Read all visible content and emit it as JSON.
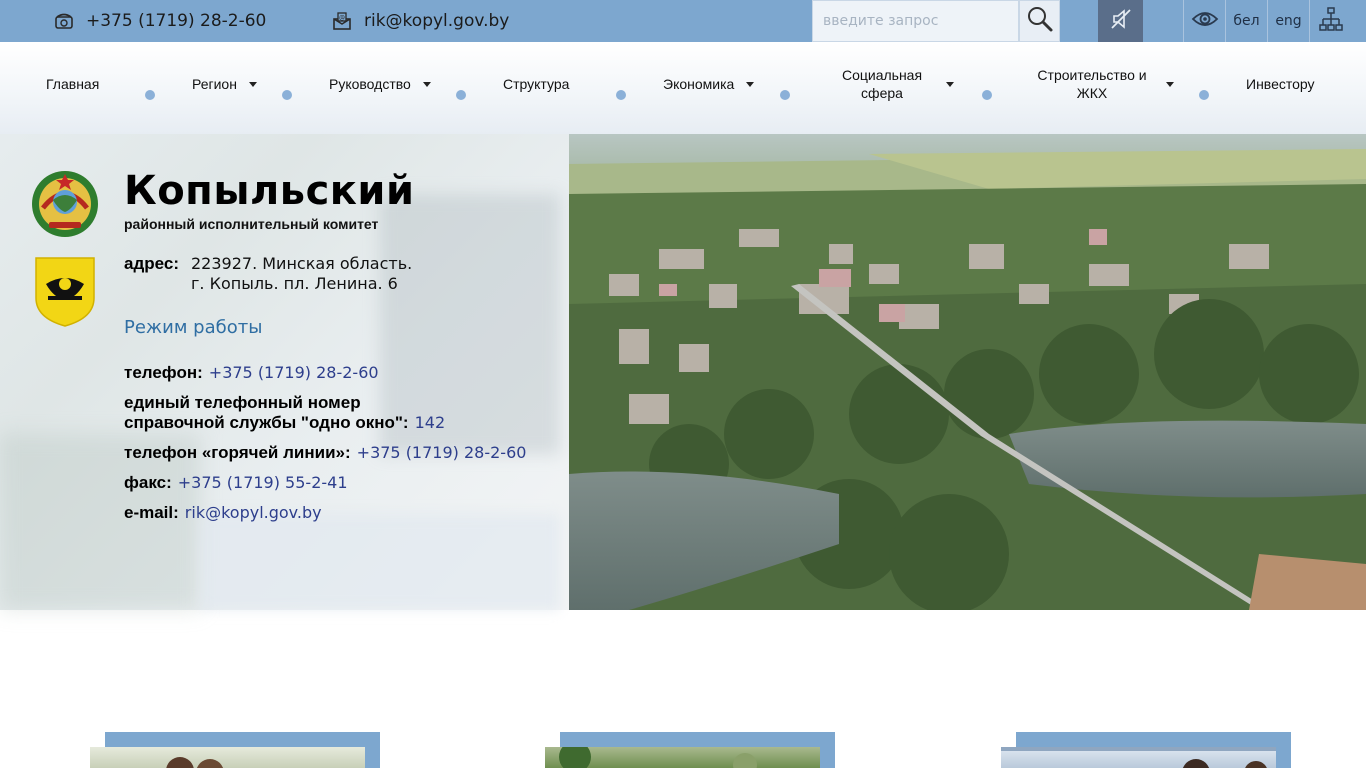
{
  "topbar": {
    "phone": "+375 (1719) 28-2-60",
    "email": "rik@kopyl.gov.by",
    "search_placeholder": "введите запрос",
    "lang_be": "бел",
    "lang_en": "eng",
    "icons": {
      "phone": "phone-icon",
      "email": "email-icon",
      "search": "search-icon",
      "sound": "sound-off-icon",
      "eye": "eye-icon",
      "sitemap": "sitemap-icon"
    }
  },
  "nav": {
    "items": [
      {
        "label": "Главная"
      },
      {
        "label": "Регион"
      },
      {
        "label": "Руководство"
      },
      {
        "label": "Структура"
      },
      {
        "label": "Экономика"
      },
      {
        "label": "Социальная сфера"
      },
      {
        "label": "Строительство и ЖКХ"
      },
      {
        "label": "Инвестору"
      }
    ]
  },
  "header": {
    "title": "Копыльский",
    "subtitle": "районный исполнительный комитет",
    "address_label": "адрес:",
    "address_line1": "223927. Минская область.",
    "address_line2": "г. Копыль. пл. Ленина. 6",
    "worktime_link": "Режим работы",
    "contacts": [
      {
        "label": "телефон:",
        "value": "+375 (1719) 28-2-60"
      },
      {
        "label": "единый телефонный номер",
        "value": ""
      },
      {
        "label": "справочной службы \"одно окно\":",
        "value": "142"
      },
      {
        "label": "телефон «горячей линии»:",
        "value": "+375 (1719) 28-2-60"
      },
      {
        "label": "факс:",
        "value": "+375 (1719) 55-2-41"
      },
      {
        "label": "e-mail:",
        "value": "rik@kopyl.gov.by"
      }
    ]
  },
  "colors": {
    "accent": "#7da7cf",
    "link": "#2f6ea3",
    "contact_value": "#2d3e8c"
  }
}
